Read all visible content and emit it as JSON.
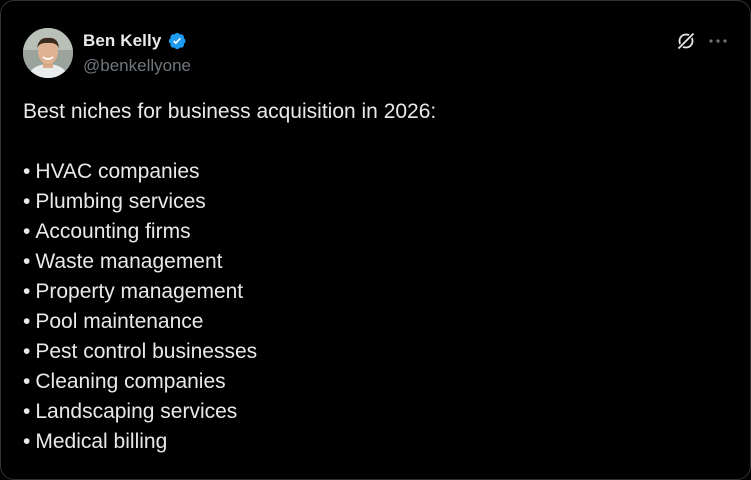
{
  "author": {
    "display_name": "Ben Kelly",
    "handle": "@benkellyone",
    "verified": true
  },
  "icons": {
    "verified": "verified-badge-icon",
    "grok": "grok-icon",
    "more": "more-options-icon"
  },
  "tweet": {
    "intro": "Best niches for business acquisition in 2026:",
    "bullet": "•",
    "items": [
      "HVAC companies",
      "Plumbing services",
      "Accounting firms",
      "Waste management",
      "Property management",
      "Pool maintenance",
      "Pest control businesses",
      "Cleaning companies",
      "Landscaping services",
      "Medical billing"
    ]
  },
  "colors": {
    "background": "#000000",
    "text_primary": "#e7e9ea",
    "text_secondary": "#71767b",
    "verified_blue": "#1d9bf0",
    "border": "#2f3336"
  }
}
